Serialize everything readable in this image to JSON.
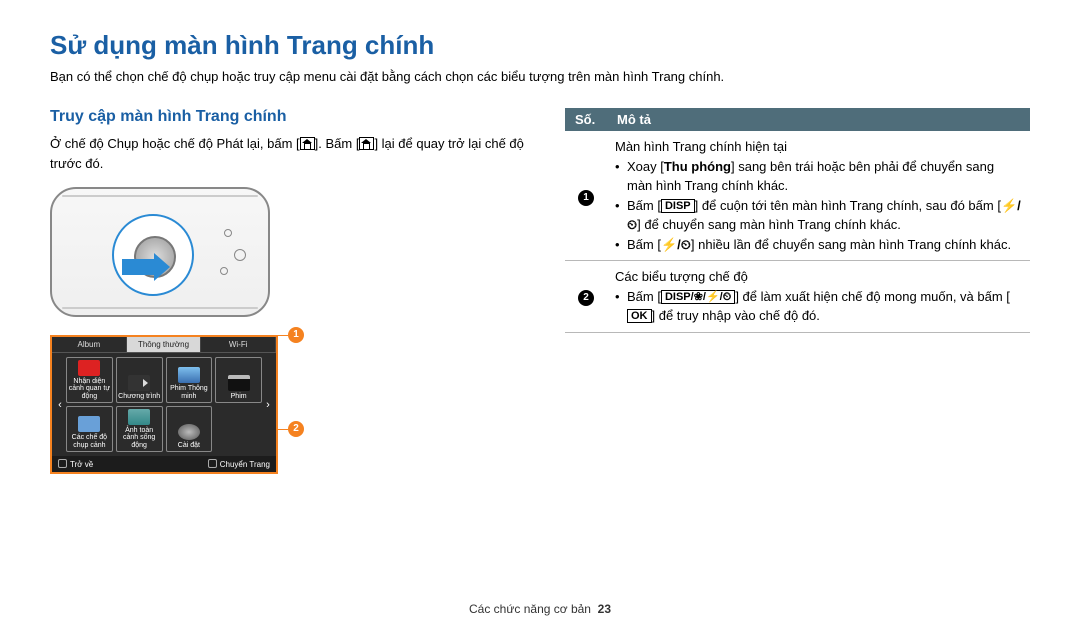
{
  "page": {
    "title": "Sử dụng màn hình Trang chính",
    "intro": "Bạn có thể chọn chế độ chụp hoặc truy cập menu cài đặt bằng cách chọn các biểu tượng trên màn hình Trang chính."
  },
  "left": {
    "heading": "Truy cập màn hình Trang chính",
    "body_pre": "Ở chế độ Chụp hoặc chế độ Phát lại, bấm [",
    "body_mid": "]. Bấm [",
    "body_post": "] lại để quay trở lại chế độ trước đó."
  },
  "screen": {
    "tabs": [
      "Album",
      "Thông thường",
      "Wi-Fi"
    ],
    "active_tab_index": 1,
    "chev_left": "‹",
    "chev_right": "›",
    "cells": [
      {
        "icon": "smart-red",
        "label": "Nhận diện cảnh quan tự động"
      },
      {
        "icon": "video",
        "label": "Chương trình"
      },
      {
        "icon": "smart-blu",
        "label": "Phim Thông minh"
      },
      {
        "icon": "clapper",
        "label": "Phim"
      },
      {
        "icon": "scn",
        "label": "Các chế độ chụp cảnh"
      },
      {
        "icon": "pano",
        "label": "Ảnh toàn cảnh sống động"
      },
      {
        "icon": "gear",
        "label": "Cài đặt"
      },
      {
        "icon": "",
        "label": ""
      }
    ],
    "footer_left": "Trở về",
    "footer_right": "Chuyển Trang"
  },
  "callouts": {
    "c1": "1",
    "c2": "2"
  },
  "table": {
    "head_num": "Số.",
    "head_desc": "Mô tả",
    "rows": [
      {
        "num": "1",
        "line1": "Màn hình Trang chính hiện tại",
        "b1_pre": "Xoay [",
        "b1_key": "Thu phóng",
        "b1_post": "] sang bên trái hoặc bên phải để chuyển sang màn hình Trang chính khác.",
        "b2_pre": "Bấm [",
        "b2_key": "DISP",
        "b2_mid": "] để cuộn tới tên màn hình Trang chính, sau đó bấm [",
        "b2_sym": "⚡/⏲",
        "b2_post": "] để chuyển sang màn hình Trang chính khác.",
        "b3_pre": "Bấm [",
        "b3_sym": "⚡/⏲",
        "b3_post": "] nhiều lần để chuyển sang màn hình Trang chính khác."
      },
      {
        "num": "2",
        "line1": "Các biểu tượng chế độ",
        "b1_pre": "Bấm [",
        "b1_key": "DISP/❀/⚡/⏲",
        "b1_mid": "] để làm xuất hiện chế độ mong muốn, và bấm [",
        "b1_key2": "OK",
        "b1_post": "] để truy nhập vào chế độ đó."
      }
    ]
  },
  "footer": {
    "section": "Các chức năng cơ bản",
    "page": "23"
  }
}
